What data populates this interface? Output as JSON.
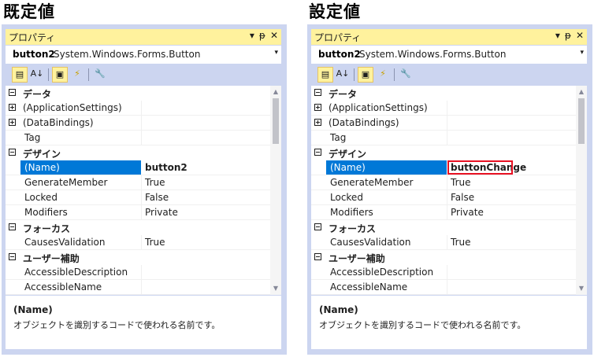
{
  "captions": {
    "left": "既定値",
    "right": "設定値"
  },
  "panel": {
    "title": "プロパティ",
    "title_icons": {
      "dropdown": "▾",
      "pin": "ᵽ",
      "close": "✕"
    },
    "object_name": "button2",
    "object_type": "System.Windows.Forms.Button",
    "object_dropdown": "▾"
  },
  "toolbar": {
    "categorized": "▤",
    "alphabetical": "A↓",
    "properties": "▣",
    "events": "⚡",
    "property_pages": "🔧"
  },
  "icons": {
    "categorized": "categorized-icon",
    "alphabetical": "alphabetical-icon",
    "properties": "properties-icon",
    "events": "lightning-icon",
    "property_pages": "wrench-icon"
  },
  "grid": {
    "cat_data": "データ",
    "app_settings": "(ApplicationSettings)",
    "data_bindings": "(DataBindings)",
    "tag": "Tag",
    "cat_design": "デザイン",
    "name": "(Name)",
    "generate_member": "GenerateMember",
    "generate_member_value": "True",
    "locked": "Locked",
    "locked_value": "False",
    "modifiers": "Modifiers",
    "modifiers_value": "Private",
    "cat_focus": "フォーカス",
    "causes_validation": "CausesValidation",
    "causes_validation_value": "True",
    "cat_accessibility": "ユーザー補助",
    "accessible_description": "AccessibleDescription",
    "accessible_name": "AccessibleName"
  },
  "values": {
    "left_name": "button2",
    "right_name": "buttonChange"
  },
  "description": {
    "title": "(Name)",
    "text": "オブジェクトを識別するコードで使われる名前です。"
  },
  "colors": {
    "panel_bg": "#ccd5f0",
    "title_bg": "#fff29d",
    "selection": "#0078d7",
    "highlight_border": "#e81123"
  }
}
